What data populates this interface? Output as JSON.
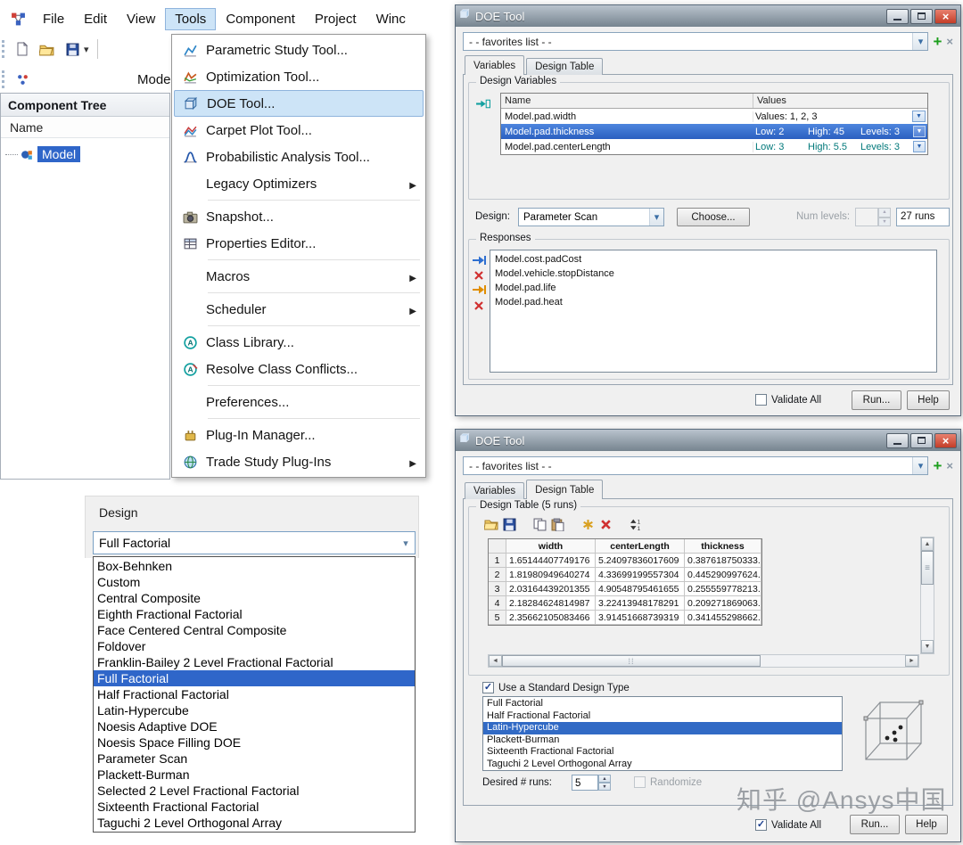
{
  "menubar": {
    "items": [
      "File",
      "Edit",
      "View",
      "Tools",
      "Component",
      "Project",
      "Winc"
    ],
    "active_item": "Tools"
  },
  "toolbar": {
    "mode_label": "Mode"
  },
  "component_tree": {
    "title": "Component Tree",
    "column_header": "Name",
    "root_item": "Model"
  },
  "tools_menu": {
    "items": [
      {
        "label": "Parametric Study Tool...",
        "icon": "parametric-study-icon"
      },
      {
        "label": "Optimization Tool...",
        "icon": "optimization-icon"
      },
      {
        "label": "DOE Tool...",
        "icon": "doe-icon",
        "highlighted": true
      },
      {
        "label": "Carpet Plot Tool...",
        "icon": "carpet-plot-icon"
      },
      {
        "label": "Probabilistic Analysis Tool...",
        "icon": "probabilistic-analysis-icon"
      },
      {
        "label": "Legacy Optimizers",
        "submenu": true
      },
      {
        "label": "Snapshot...",
        "icon": "snapshot-icon"
      },
      {
        "label": "Properties Editor...",
        "icon": "properties-editor-icon"
      },
      {
        "label": "Macros",
        "submenu": true
      },
      {
        "label": "Scheduler",
        "submenu": true
      },
      {
        "label": "Class Library...",
        "icon": "class-library-icon"
      },
      {
        "label": "Resolve Class Conflicts...",
        "icon": "resolve-class-conflicts-icon"
      },
      {
        "label": "Preferences..."
      },
      {
        "label": "Plug-In Manager...",
        "icon": "plugin-manager-icon"
      },
      {
        "label": "Trade Study Plug-Ins",
        "icon": "trade-study-icon",
        "submenu": true
      }
    ]
  },
  "design_dropdown": {
    "label": "Design",
    "value": "Full Factorial",
    "selected_option": "Full Factorial",
    "options": [
      "Box-Behnken",
      "Custom",
      "Central Composite",
      "Eighth Fractional Factorial",
      "Face Centered Central Composite",
      "Foldover",
      "Franklin-Bailey 2 Level Fractional Factorial",
      "Full Factorial",
      "Half Fractional Factorial",
      "Latin-Hypercube",
      "Noesis Adaptive DOE",
      "Noesis Space Filling DOE",
      "Parameter Scan",
      "Plackett-Burman",
      "Selected 2 Level Fractional Factorial",
      "Sixteenth Fractional Factorial",
      "Taguchi 2 Level Orthogonal Array"
    ]
  },
  "doe_variables_dialog": {
    "title": "DOE Tool",
    "favorites_value": "- - favorites list - -",
    "tabs": [
      "Variables",
      "Design Table"
    ],
    "active_tab": "Variables",
    "design_variables_group": "Design Variables",
    "table": {
      "headers": [
        "Name",
        "Values"
      ],
      "rows": [
        {
          "name": "Model.pad.width",
          "values": "Values: 1, 2, 3",
          "selected": false
        },
        {
          "name": "Model.pad.thickness",
          "low": "Low: 2",
          "high": "High: 45",
          "levels": "Levels: 3",
          "selected": true
        },
        {
          "name": "Model.pad.centerLength",
          "low": "Low: 3",
          "high": "High: 5.5",
          "levels": "Levels: 3",
          "selected": false
        }
      ]
    },
    "design_label": "Design:",
    "design_combo_value": "Parameter Scan",
    "choose_button": "Choose...",
    "num_levels_label": "Num levels:",
    "num_levels_enabled": false,
    "runs_value": "27 runs",
    "responses_group": "Responses",
    "responses": [
      "Model.cost.padCost",
      "Model.vehicle.stopDistance",
      "Model.pad.life",
      "Model.pad.heat"
    ],
    "validate_all_label": "Validate All",
    "validate_all_checked": false,
    "run_button": "Run...",
    "help_button": "Help"
  },
  "doe_table_dialog": {
    "title": "DOE Tool",
    "favorites_value": "- - favorites list - -",
    "tabs": [
      "Variables",
      "Design Table"
    ],
    "active_tab": "Design Table",
    "group_title": "Design Table (5 runs)",
    "table": {
      "headers": [
        "width",
        "centerLength",
        "thickness"
      ],
      "rows": [
        {
          "num": "1",
          "width": "1.65144407749176",
          "centerLength": "5.24097836017609",
          "thickness": "0.387618750333..."
        },
        {
          "num": "2",
          "width": "1.81980949640274",
          "centerLength": "4.33699199557304",
          "thickness": "0.445290997624..."
        },
        {
          "num": "3",
          "width": "2.03164439201355",
          "centerLength": "4.90548795461655",
          "thickness": "0.255559778213..."
        },
        {
          "num": "4",
          "width": "2.18284624814987",
          "centerLength": "3.22413948178291",
          "thickness": "0.209271869063..."
        },
        {
          "num": "5",
          "width": "2.35662105083466",
          "centerLength": "3.91451668739319",
          "thickness": "0.341455298662..."
        }
      ]
    },
    "standard_type_checkbox": "Use a Standard Design Type",
    "standard_type_checked": true,
    "design_types": [
      "Full Factorial",
      "Half Fractional Factorial",
      "Latin-Hypercube",
      "Plackett-Burman",
      "Sixteenth Fractional Factorial",
      "Taguchi 2 Level Orthogonal Array"
    ],
    "selected_type": "Latin-Hypercube",
    "desired_runs_label": "Desired # runs:",
    "desired_runs_value": "5",
    "randomize_label": "Randomize",
    "randomize_enabled": false,
    "validate_all_label": "Validate All",
    "validate_all_checked": true,
    "run_button": "Run...",
    "help_button": "Help"
  },
  "watermark": "知乎 @Ansys中国",
  "colors": {
    "selection_blue": "#2f66c9",
    "menu_highlight": "#cde4f7",
    "value_teal": "#00787a",
    "close_button_red": "#c33d28",
    "favorites_add_green": "#1b9e1b"
  }
}
